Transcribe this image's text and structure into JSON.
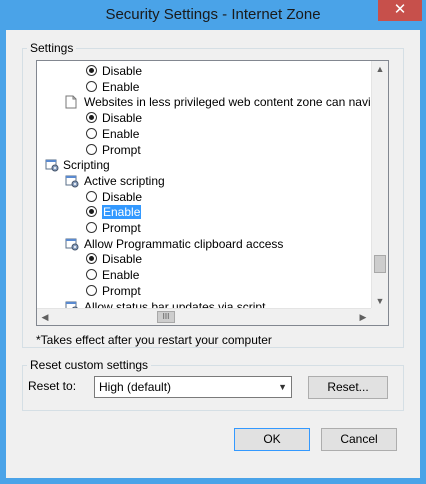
{
  "window": {
    "title": "Security Settings - Internet Zone",
    "close_glyph": "✕"
  },
  "settings": {
    "group_label": "Settings",
    "rows": [
      {
        "kind": "radio",
        "label": "Disable",
        "checked": true
      },
      {
        "kind": "radio",
        "label": "Enable",
        "checked": false
      },
      {
        "kind": "item",
        "label": "Websites in less privileged web content zone can navigate in",
        "icon": "page-icon"
      },
      {
        "kind": "radio",
        "label": "Disable",
        "checked": true
      },
      {
        "kind": "radio",
        "label": "Enable",
        "checked": false
      },
      {
        "kind": "radio",
        "label": "Prompt",
        "checked": false
      },
      {
        "kind": "category",
        "label": "Scripting",
        "icon": "script-settings-icon"
      },
      {
        "kind": "item",
        "label": "Active scripting",
        "icon": "script-settings-icon"
      },
      {
        "kind": "radio",
        "label": "Disable",
        "checked": false
      },
      {
        "kind": "radio",
        "label": "Enable",
        "checked": true,
        "selected": true
      },
      {
        "kind": "radio",
        "label": "Prompt",
        "checked": false
      },
      {
        "kind": "item",
        "label": "Allow Programmatic clipboard access",
        "icon": "script-settings-icon"
      },
      {
        "kind": "radio",
        "label": "Disable",
        "checked": true
      },
      {
        "kind": "radio",
        "label": "Enable",
        "checked": false
      },
      {
        "kind": "radio",
        "label": "Prompt",
        "checked": false
      },
      {
        "kind": "item",
        "label": "Allow status bar updates via script",
        "icon": "script-settings-icon"
      }
    ],
    "note": "*Takes effect after you restart your computer",
    "scroll_up": "▲",
    "scroll_down": "▼",
    "scroll_left": "◀",
    "scroll_right": "▶",
    "thumb_grip": "III"
  },
  "reset": {
    "group_label": "Reset custom settings",
    "reset_to_label": "Reset to:",
    "selected_value": "High (default)",
    "dropdown_arrow": "▼",
    "reset_button": "Reset..."
  },
  "footer": {
    "ok_button": "OK",
    "cancel_button": "Cancel"
  },
  "colors": {
    "frame": "#4aa3e8",
    "selection": "#3399ff",
    "close": "#c7504b"
  }
}
